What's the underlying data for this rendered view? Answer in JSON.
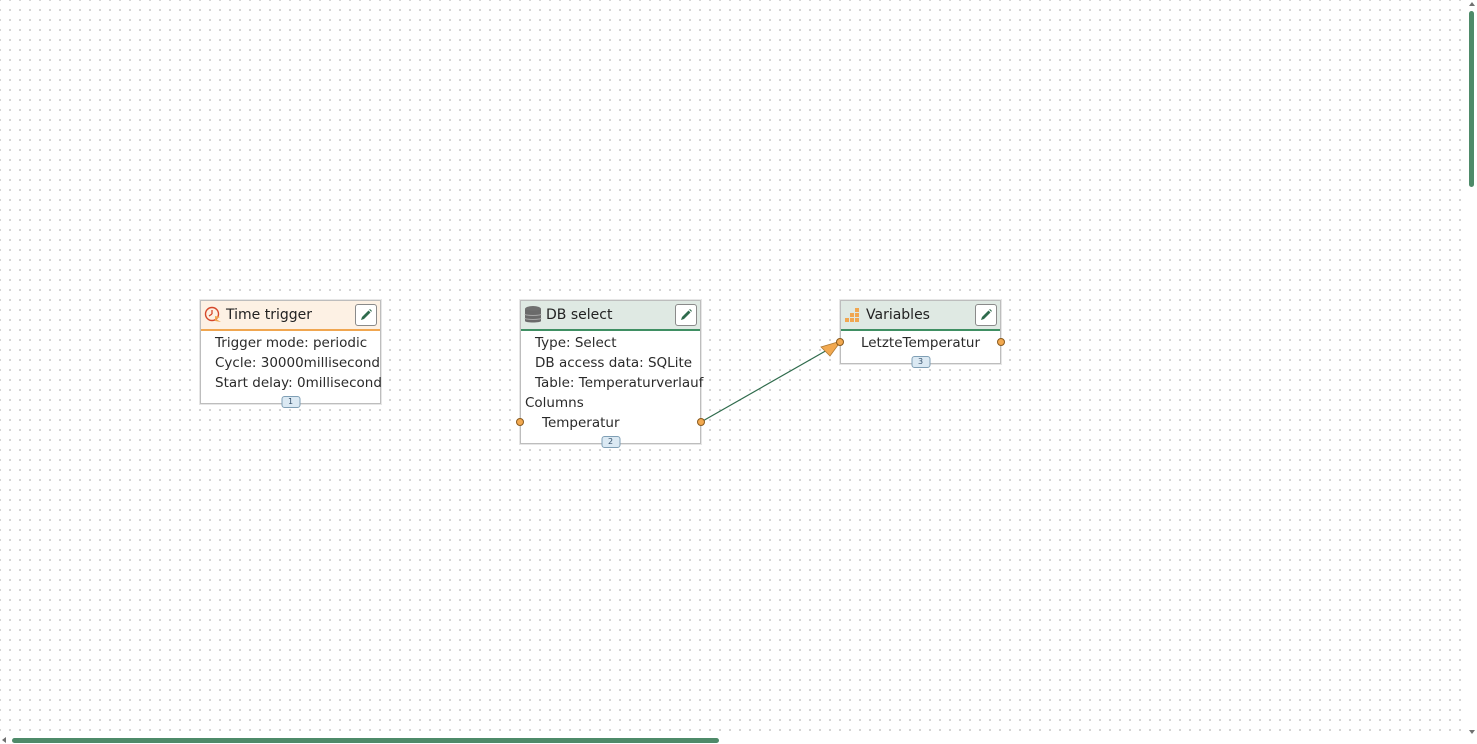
{
  "nodes": {
    "time_trigger": {
      "title": "Time trigger",
      "icon": "clock-trigger-icon",
      "lines": [
        "Trigger mode: periodic",
        "Cycle: 30000millisecond",
        "Start delay: 0millisecond"
      ],
      "badge": "1"
    },
    "db_select": {
      "title": "DB select",
      "icon": "database-icon",
      "lines": [
        "Type: Select",
        "DB access data: SQLite",
        "Table: Temperaturverlauf"
      ],
      "columns_label": "Columns",
      "columns": [
        "Temperatur"
      ],
      "badge": "2"
    },
    "variables": {
      "title": "Variables",
      "icon": "variables-icon",
      "lines": [
        "LetzteTemperatur"
      ],
      "badge": "3"
    }
  },
  "colors": {
    "accent_green": "#3f8f63",
    "accent_orange": "#f0a650",
    "port": "#f2a950",
    "edge": "#2f6b4c",
    "scrollbar": "#4e8a69"
  },
  "icons": {
    "edit": "pencil-icon"
  }
}
